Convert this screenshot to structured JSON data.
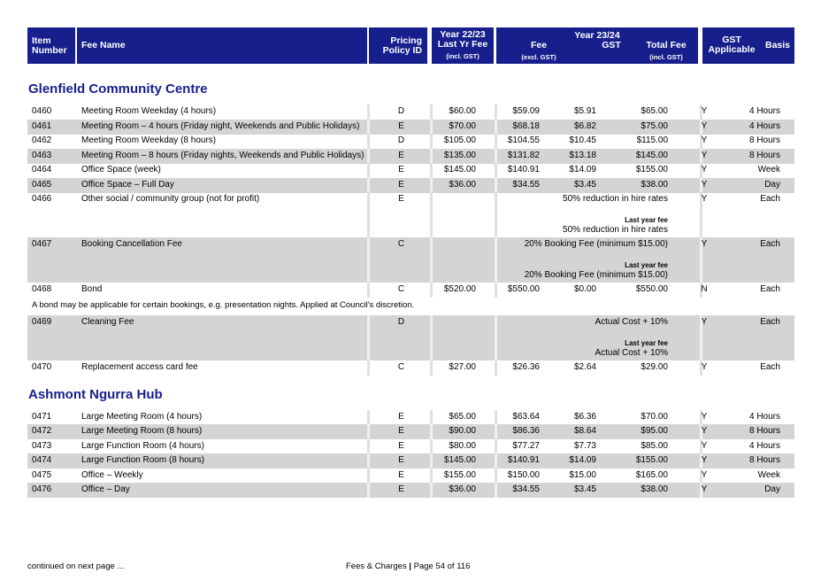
{
  "header": {
    "item_number": [
      "Item",
      "Number"
    ],
    "fee_name": "Fee Name",
    "pricing_policy": [
      "Pricing",
      "Policy ID"
    ],
    "year_prev": [
      "Year 22/23",
      "Last Yr Fee",
      "(incl. GST)"
    ],
    "year_curr": "Year 23/24",
    "fee": [
      "Fee",
      "(excl. GST)"
    ],
    "gst": "GST",
    "total_fee": [
      "Total Fee",
      "(incl. GST)"
    ],
    "gst_applicable": [
      "GST",
      "Applicable"
    ],
    "basis": "Basis"
  },
  "sections": [
    {
      "title": "Glenfield Community Centre",
      "rows": [
        {
          "item": "0460",
          "name": "Meeting Room Weekday (4 hours)",
          "policy": "D",
          "last": "$60.00",
          "fee": "$59.09",
          "gst": "$5.91",
          "total": "$65.00",
          "gst_app": "Y",
          "basis": "4 Hours"
        },
        {
          "item": "0461",
          "name": "Meeting Room – 4 hours (Friday night, Weekends and Public Holidays)",
          "policy": "E",
          "last": "$70.00",
          "fee": "$68.18",
          "gst": "$6.82",
          "total": "$75.00",
          "gst_app": "Y",
          "basis": "4 Hours"
        },
        {
          "item": "0462",
          "name": "Meeting Room Weekday (8 hours)",
          "policy": "D",
          "last": "$105.00",
          "fee": "$104.55",
          "gst": "$10.45",
          "total": "$115.00",
          "gst_app": "Y",
          "basis": "8 Hours"
        },
        {
          "item": "0463",
          "name": "Meeting Room – 8 hours (Friday nights, Weekends and Public Holidays)",
          "policy": "E",
          "last": "$135.00",
          "fee": "$131.82",
          "gst": "$13.18",
          "total": "$145.00",
          "gst_app": "Y",
          "basis": "8 Hours"
        },
        {
          "item": "0464",
          "name": "Office Space (week)",
          "policy": "E",
          "last": "$145.00",
          "fee": "$140.91",
          "gst": "$14.09",
          "total": "$155.00",
          "gst_app": "Y",
          "basis": "Week"
        },
        {
          "item": "0465",
          "name": "Office Space – Full Day",
          "policy": "E",
          "last": "$36.00",
          "fee": "$34.55",
          "gst": "$3.45",
          "total": "$38.00",
          "gst_app": "Y",
          "basis": "Day"
        },
        {
          "item": "0466",
          "name": "Other social / community group (not for profit)",
          "policy": "E",
          "text": "50% reduction in hire rates",
          "last_year_label": "Last year fee",
          "last_year_text": "50% reduction in hire rates",
          "gst_app": "Y",
          "basis": "Each"
        },
        {
          "item": "0467",
          "name": "Booking Cancellation Fee",
          "policy": "C",
          "text": "20% Booking Fee (minimum $15.00)",
          "last_year_label": "Last year fee",
          "last_year_text": "20% Booking Fee (minimum $15.00)",
          "gst_app": "Y",
          "basis": "Each"
        },
        {
          "item": "0468",
          "name": "Bond",
          "policy": "C",
          "last": "$520.00",
          "fee": "$550.00",
          "gst": "$0.00",
          "total": "$550.00",
          "gst_app": "N",
          "basis": "Each"
        },
        {
          "item": "0469",
          "name": "Cleaning Fee",
          "policy": "D",
          "text": "Actual Cost + 10%",
          "last_year_label": "Last year fee",
          "last_year_text": "Actual Cost + 10%",
          "gst_app": "Y",
          "basis": "Each"
        },
        {
          "item": "0470",
          "name": "Replacement access card fee",
          "policy": "C",
          "last": "$27.00",
          "fee": "$26.36",
          "gst": "$2.64",
          "total": "$29.00",
          "gst_app": "Y",
          "basis": "Each"
        }
      ],
      "note": "A bond may be applicable for certain bookings, e.g. presentation nights. Applied at Council's discretion."
    },
    {
      "title": "Ashmont Ngurra Hub",
      "rows": [
        {
          "item": "0471",
          "name": "Large Meeting Room (4 hours)",
          "policy": "E",
          "last": "$65.00",
          "fee": "$63.64",
          "gst": "$6.36",
          "total": "$70.00",
          "gst_app": "Y",
          "basis": "4 Hours"
        },
        {
          "item": "0472",
          "name": "Large Meeting Room (8 hours)",
          "policy": "E",
          "last": "$90.00",
          "fee": "$86.36",
          "gst": "$8.64",
          "total": "$95.00",
          "gst_app": "Y",
          "basis": "8 Hours"
        },
        {
          "item": "0473",
          "name": "Large Function Room (4 hours)",
          "policy": "E",
          "last": "$80.00",
          "fee": "$77.27",
          "gst": "$7.73",
          "total": "$85.00",
          "gst_app": "Y",
          "basis": "4 Hours"
        },
        {
          "item": "0474",
          "name": "Large Function Room (8 hours)",
          "policy": "E",
          "last": "$145.00",
          "fee": "$140.91",
          "gst": "$14.09",
          "total": "$155.00",
          "gst_app": "Y",
          "basis": "8 Hours"
        },
        {
          "item": "0475",
          "name": "Office – Weekly",
          "policy": "E",
          "last": "$155.00",
          "fee": "$150.00",
          "gst": "$15.00",
          "total": "$165.00",
          "gst_app": "Y",
          "basis": "Week"
        },
        {
          "item": "0476",
          "name": "Office – Day",
          "policy": "E",
          "last": "$36.00",
          "fee": "$34.55",
          "gst": "$3.45",
          "total": "$38.00",
          "gst_app": "Y",
          "basis": "Day"
        }
      ]
    }
  ],
  "footer": {
    "continued": "continued on next page ...",
    "page_prefix": "Fees & Charges ",
    "page_sep": "|",
    "page_text": " Page 54 of 116"
  }
}
